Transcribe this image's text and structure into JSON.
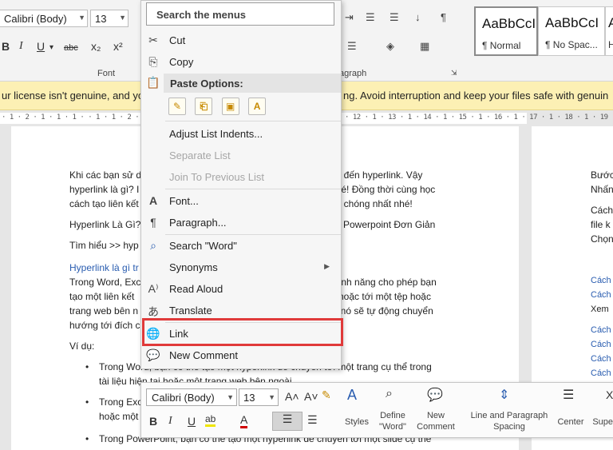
{
  "ribbon": {
    "font_name": "Calibri (Body)",
    "font_size": "13",
    "font_group_label": "Font",
    "paragraph_group_label": "agraph",
    "bold": "B",
    "italic": "I",
    "underline": "U",
    "strikethrough": "abc",
    "subscript": "x₂",
    "superscript": "x²",
    "styles": [
      {
        "sample": "AaBbCcI",
        "name": "¶ Normal"
      },
      {
        "sample": "AaBbCcI",
        "name": "¶ No Spac..."
      },
      {
        "sample": "A",
        "name": "H"
      }
    ]
  },
  "banner": {
    "text_left": "ur license isn't genuine, and yo",
    "text_right": "ng. Avoid interruption and keep your files safe with genuin"
  },
  "ruler": {
    "left": "· 1 · 2 · 1 · 1 · 1 ·   · 1 · 1 · 2 · 1 · 3",
    "right": "· 12 · 1 · 13 · 1 · 14 · 1 · 15 · 1 · 16 · 1 · 17 · 1 · 18 · 1 · 19"
  },
  "doc": {
    "left_lines": [
      "Khi các bạn sử d",
      "hyperlink là gì? I",
      "cách tạo liên kết",
      "Hyperlink Là Gì?",
      "Tìm hiểu >> hyp",
      "Hyperlink là gì tr",
      "Trong Word, Exc",
      "tạo một liên kết",
      "trang web bên n",
      "hướng tới đích c",
      "Ví dụ:"
    ],
    "right_lines": [
      "ne đến hyperlink. Vậy",
      "nhé! Đồng thời cùng học",
      "nh chóng nhất nhé!",
      "el, Powerpoint Đơn Giản",
      "t tính năng cho phép bạn",
      "o hoặc tới một tệp hoặc",
      "k, nó sẽ tự động chuyển"
    ],
    "bullets": [
      "Trong Word, bạn có thể tạo một hyperlink để chuyển tới một trang cụ thể trong",
      "tài liệu hiện tại hoặc một trang web bên ngoài",
      "Trong Exc",
      "hoặc một",
      "Trong PowerPoint, bạn có thể tạo một hyperlink để chuyển tới một slide cụ thể"
    ],
    "page2_lines": [
      "Bước",
      "Nhấn",
      "Cách",
      "file k",
      "Chọn",
      "Cách",
      "Cách",
      "Xem",
      "Cách",
      "Cách",
      "Cách",
      "Cách"
    ]
  },
  "menu": {
    "search_placeholder": "Search the menus",
    "cut": "Cut",
    "copy": "Copy",
    "paste_options": "Paste Options:",
    "adjust_list_indents": "Adjust List Indents...",
    "separate_list": "Separate List",
    "join_previous_list": "Join To Previous List",
    "font": "Font...",
    "paragraph": "Paragraph...",
    "search_word": "Search \"Word\"",
    "synonyms": "Synonyms",
    "read_aloud": "Read Aloud",
    "translate": "Translate",
    "link": "Link",
    "new_comment": "New Comment"
  },
  "mini": {
    "font_name": "Calibri (Body)",
    "font_size": "13",
    "styles": "Styles",
    "define_word": "Define \"Word\"",
    "new_comment": "New Comment",
    "line_spacing": "Line and Paragraph Spacing",
    "center": "Center",
    "superscript": "Super"
  },
  "colors": {
    "banner_bg": "#fcf0b4",
    "highlight_border": "#e03a3a",
    "link_blue": "#2a5db0"
  }
}
